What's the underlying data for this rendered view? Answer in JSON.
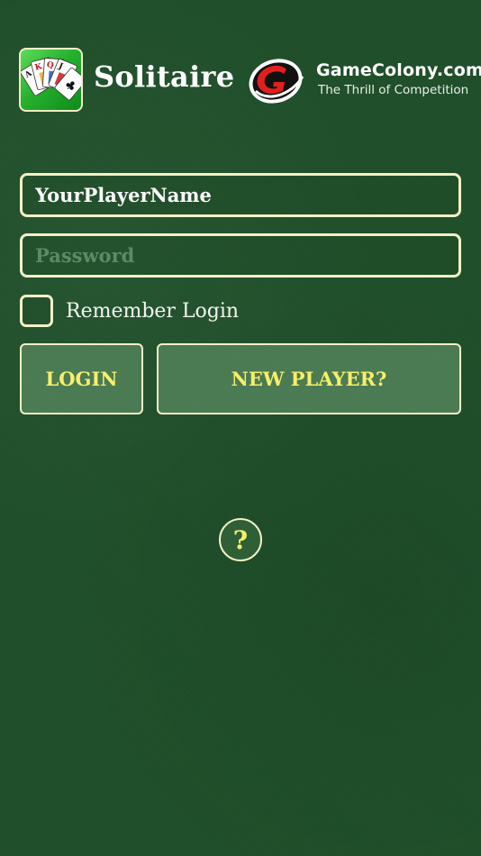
{
  "app": {
    "title": "Solitaire",
    "icon": "solitaire-cards-icon"
  },
  "brand": {
    "name": "GameColony.com",
    "tagline": "The Thrill of Competition",
    "logo": "gamecolony-logo"
  },
  "login_form": {
    "username_value": "YourPlayerName",
    "password_placeholder": "Password",
    "remember_label": "Remember Login",
    "remember_checked": false,
    "login_button": "LOGIN",
    "new_player_button": "NEW PLAYER?",
    "help_button": "?"
  },
  "colors": {
    "background": "#1f4f2a",
    "border": "#f3f0c6",
    "button_text": "#f7ef6a",
    "button_fill": "#4a7a52"
  }
}
